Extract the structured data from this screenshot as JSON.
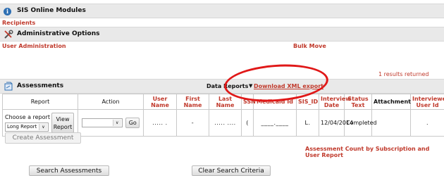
{
  "modules": {
    "title": "SIS Online Modules",
    "recipients": "Recipients"
  },
  "admin": {
    "title": "Administrative Options",
    "user_admin": "User Administration",
    "bulk_move": "Bulk Move"
  },
  "results": {
    "text": "1 results returned"
  },
  "assessments": {
    "title": "Assessments",
    "data_reports": "Data Reports",
    "download_arrow": "▼",
    "download_link": "Download XML export"
  },
  "table": {
    "headers": {
      "report": "Report",
      "action": "Action",
      "user_name": "User Name",
      "first_name": "First Name",
      "last_name": "Last Name",
      "ssn": "SSN",
      "medicaid_id": "Medicaid Id",
      "sis_id": "SIS_ID",
      "interview_date": "Interview Date",
      "status_text": "Status Text",
      "attachment": "Attachment",
      "interviewer_user_id": "Interviewer User Id"
    },
    "row": {
      "choose_report": "Choose a report",
      "report_select": "Long Report",
      "view_report": "View Report",
      "action_select": "",
      "go": "Go",
      "user_name": "..... .",
      "first_name": "-",
      "last_name": "..... ....",
      "ssn": "(",
      "medicaid_id": "____.____",
      "sis_id": "L.",
      "interview_date": "12/04/2014",
      "status_text": "Completed",
      "attachment": "",
      "interviewer_user_id": "."
    }
  },
  "create_assessment": "Create Assessment",
  "count_link": "Assessment Count by Subscription and User Report",
  "search_assessments": "Search Assessments",
  "clear_search": "Clear Search Criteria",
  "colors": {
    "accent_red": "#c0392b",
    "bar_gray": "#e9e9e9",
    "annotation_red": "#e01818"
  }
}
